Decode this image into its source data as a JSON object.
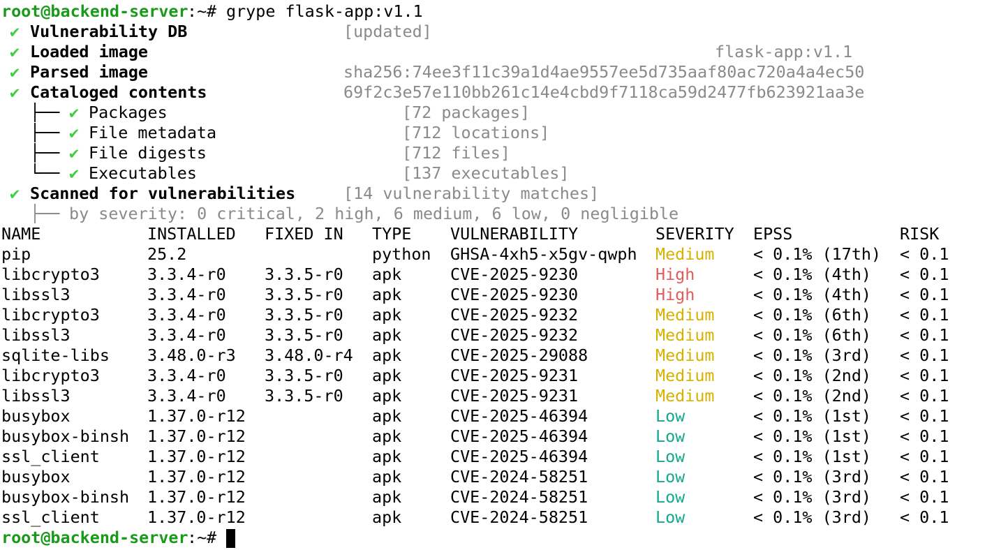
{
  "prompt": {
    "user_host": "root@backend-server",
    "path": ":~",
    "symbol": "# ",
    "command": "grype flask-app:v1.1"
  },
  "icons": {
    "check": "✔"
  },
  "steps": {
    "vuln_db": {
      "label": "Vulnerability DB",
      "value": "[updated]"
    },
    "loaded_image": {
      "label": "Loaded image",
      "value": "flask-app:v1.1"
    },
    "parsed_image": {
      "label": "Parsed image",
      "value": "sha256:74ee3f11c39a1d4ae9557ee5d735aaf80ac720a4a4ec50"
    },
    "cataloged": {
      "label": "Cataloged contents",
      "value": "69f2c3e57e110bb261c14e4cbd9f7118ca59d2477fb623921aa3e"
    },
    "packages": {
      "label": "Packages",
      "value": "[72 packages]"
    },
    "file_metadata": {
      "label": "File metadata",
      "value": "[712 locations]"
    },
    "file_digests": {
      "label": "File digests",
      "value": "[712 files]"
    },
    "executables": {
      "label": "Executables",
      "value": "[137 executables]"
    },
    "scanned": {
      "label": "Scanned for vulnerabilities",
      "value": "[14 vulnerability matches]"
    },
    "severity_summary": "by severity: 0 critical, 2 high, 6 medium, 6 low, 0 negligible"
  },
  "table": {
    "headers": {
      "name": "NAME",
      "installed": "INSTALLED",
      "fixed": "FIXED IN",
      "type": "TYPE",
      "vuln": "VULNERABILITY",
      "severity": "SEVERITY",
      "epss": "EPSS",
      "risk": "RISK"
    },
    "rows": [
      {
        "name": "pip",
        "installed": "25.2",
        "fixed": "",
        "type": "python",
        "vuln": "GHSA-4xh5-x5gv-qwph",
        "severity": "Medium",
        "epss": "< 0.1% (17th)",
        "risk": "< 0.1"
      },
      {
        "name": "libcrypto3",
        "installed": "3.3.4-r0",
        "fixed": "3.3.5-r0",
        "type": "apk",
        "vuln": "CVE-2025-9230",
        "severity": "High",
        "epss": "< 0.1% (4th)",
        "risk": "< 0.1"
      },
      {
        "name": "libssl3",
        "installed": "3.3.4-r0",
        "fixed": "3.3.5-r0",
        "type": "apk",
        "vuln": "CVE-2025-9230",
        "severity": "High",
        "epss": "< 0.1% (4th)",
        "risk": "< 0.1"
      },
      {
        "name": "libcrypto3",
        "installed": "3.3.4-r0",
        "fixed": "3.3.5-r0",
        "type": "apk",
        "vuln": "CVE-2025-9232",
        "severity": "Medium",
        "epss": "< 0.1% (6th)",
        "risk": "< 0.1"
      },
      {
        "name": "libssl3",
        "installed": "3.3.4-r0",
        "fixed": "3.3.5-r0",
        "type": "apk",
        "vuln": "CVE-2025-9232",
        "severity": "Medium",
        "epss": "< 0.1% (6th)",
        "risk": "< 0.1"
      },
      {
        "name": "sqlite-libs",
        "installed": "3.48.0-r3",
        "fixed": "3.48.0-r4",
        "type": "apk",
        "vuln": "CVE-2025-29088",
        "severity": "Medium",
        "epss": "< 0.1% (3rd)",
        "risk": "< 0.1"
      },
      {
        "name": "libcrypto3",
        "installed": "3.3.4-r0",
        "fixed": "3.3.5-r0",
        "type": "apk",
        "vuln": "CVE-2025-9231",
        "severity": "Medium",
        "epss": "< 0.1% (2nd)",
        "risk": "< 0.1"
      },
      {
        "name": "libssl3",
        "installed": "3.3.4-r0",
        "fixed": "3.3.5-r0",
        "type": "apk",
        "vuln": "CVE-2025-9231",
        "severity": "Medium",
        "epss": "< 0.1% (2nd)",
        "risk": "< 0.1"
      },
      {
        "name": "busybox",
        "installed": "1.37.0-r12",
        "fixed": "",
        "type": "apk",
        "vuln": "CVE-2025-46394",
        "severity": "Low",
        "epss": "< 0.1% (1st)",
        "risk": "< 0.1"
      },
      {
        "name": "busybox-binsh",
        "installed": "1.37.0-r12",
        "fixed": "",
        "type": "apk",
        "vuln": "CVE-2025-46394",
        "severity": "Low",
        "epss": "< 0.1% (1st)",
        "risk": "< 0.1"
      },
      {
        "name": "ssl_client",
        "installed": "1.37.0-r12",
        "fixed": "",
        "type": "apk",
        "vuln": "CVE-2025-46394",
        "severity": "Low",
        "epss": "< 0.1% (1st)",
        "risk": "< 0.1"
      },
      {
        "name": "busybox",
        "installed": "1.37.0-r12",
        "fixed": "",
        "type": "apk",
        "vuln": "CVE-2024-58251",
        "severity": "Low",
        "epss": "< 0.1% (3rd)",
        "risk": "< 0.1"
      },
      {
        "name": "busybox-binsh",
        "installed": "1.37.0-r12",
        "fixed": "",
        "type": "apk",
        "vuln": "CVE-2024-58251",
        "severity": "Low",
        "epss": "< 0.1% (3rd)",
        "risk": "< 0.1"
      },
      {
        "name": "ssl_client",
        "installed": "1.37.0-r12",
        "fixed": "",
        "type": "apk",
        "vuln": "CVE-2024-58251",
        "severity": "Low",
        "epss": "< 0.1% (3rd)",
        "risk": "< 0.1"
      }
    ]
  },
  "colors": {
    "prompt": "#1a9a1a",
    "check": "#3fce3f",
    "muted": "#8a8a8a",
    "medium": "#d7b100",
    "high": "#e25c5c",
    "low": "#14a98e"
  }
}
